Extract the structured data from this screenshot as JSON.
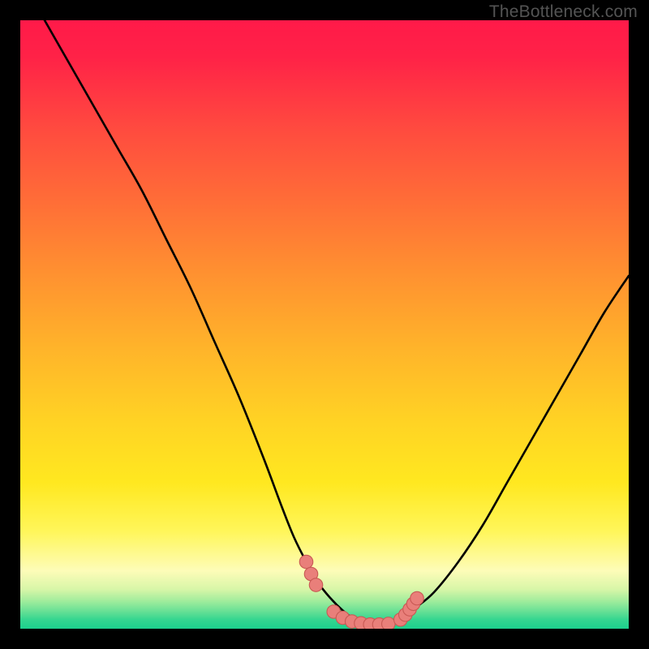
{
  "watermark": "TheBottleneck.com",
  "colors": {
    "black": "#000000",
    "wm": "#545454",
    "curve": "#000000",
    "marker_fill": "#e97f7a",
    "marker_stroke": "#c95a55",
    "grad_stops": [
      {
        "offset": 0.0,
        "color": "#ff1a49"
      },
      {
        "offset": 0.06,
        "color": "#ff2247"
      },
      {
        "offset": 0.18,
        "color": "#ff4b3f"
      },
      {
        "offset": 0.3,
        "color": "#ff6e37"
      },
      {
        "offset": 0.42,
        "color": "#ff9230"
      },
      {
        "offset": 0.54,
        "color": "#ffb42a"
      },
      {
        "offset": 0.66,
        "color": "#ffd324"
      },
      {
        "offset": 0.76,
        "color": "#ffe820"
      },
      {
        "offset": 0.84,
        "color": "#fff65a"
      },
      {
        "offset": 0.905,
        "color": "#fdfcb8"
      },
      {
        "offset": 0.935,
        "color": "#d8f6a8"
      },
      {
        "offset": 0.955,
        "color": "#9fec9c"
      },
      {
        "offset": 0.972,
        "color": "#65e095"
      },
      {
        "offset": 0.985,
        "color": "#35d690"
      },
      {
        "offset": 1.0,
        "color": "#1cd08d"
      }
    ]
  },
  "chart_data": {
    "type": "line",
    "title": "",
    "xlabel": "",
    "ylabel": "",
    "xlim": [
      0,
      100
    ],
    "ylim": [
      0,
      100
    ],
    "series": [
      {
        "name": "left-curve",
        "x": [
          4,
          8,
          12,
          16,
          20,
          24,
          28,
          32,
          36,
          40,
          43,
          45,
          47,
          49,
          51,
          53,
          55,
          57
        ],
        "y": [
          100,
          93,
          86,
          79,
          72,
          64,
          56,
          47,
          38,
          28,
          20,
          15,
          11,
          7.5,
          5,
          3,
          1.5,
          0.8
        ]
      },
      {
        "name": "right-curve",
        "x": [
          61,
          63,
          65,
          68,
          72,
          76,
          80,
          84,
          88,
          92,
          96,
          100
        ],
        "y": [
          1,
          2,
          3.5,
          6,
          11,
          17,
          24,
          31,
          38,
          45,
          52,
          58
        ]
      }
    ],
    "flat_bottom": {
      "x_start": 57,
      "x_end": 61,
      "y": 0.6
    },
    "markers": {
      "name": "bottom-markers",
      "points": [
        {
          "x": 47.0,
          "y": 11.0
        },
        {
          "x": 47.8,
          "y": 9.0
        },
        {
          "x": 48.6,
          "y": 7.2
        },
        {
          "x": 51.5,
          "y": 2.8
        },
        {
          "x": 53.0,
          "y": 1.8
        },
        {
          "x": 54.5,
          "y": 1.2
        },
        {
          "x": 56.0,
          "y": 0.9
        },
        {
          "x": 57.5,
          "y": 0.7
        },
        {
          "x": 59.0,
          "y": 0.7
        },
        {
          "x": 60.5,
          "y": 0.8
        },
        {
          "x": 62.5,
          "y": 1.5
        },
        {
          "x": 63.3,
          "y": 2.3
        },
        {
          "x": 64.0,
          "y": 3.2
        },
        {
          "x": 64.6,
          "y": 4.1
        },
        {
          "x": 65.2,
          "y": 5.0
        }
      ],
      "r": 1.1
    }
  }
}
